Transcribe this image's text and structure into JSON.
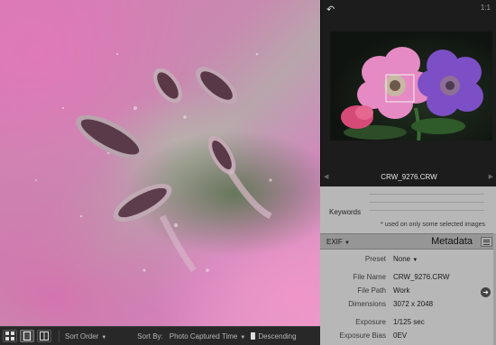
{
  "navigator": {
    "zoom": "1:1",
    "back_icon": "undo-arrow-icon",
    "filename": "CRW_9276.CRW"
  },
  "keywords": {
    "label": "Keywords",
    "note": "* used on only some selected images"
  },
  "metadata": {
    "preset_menu": "EXIF",
    "title": "Metadata",
    "rows": [
      {
        "label": "Preset",
        "value": "None"
      },
      {
        "label": "File Name",
        "value": "CRW_9276.CRW"
      },
      {
        "label": "File Path",
        "value": "Work"
      },
      {
        "label": "Dimensions",
        "value": "3072 x 2048"
      },
      {
        "label": "Exposure",
        "value": "1/125 sec"
      },
      {
        "label": "Exposure Bias",
        "value": "0EV"
      }
    ]
  },
  "toolbar": {
    "sort_order_label": "Sort Order",
    "sort_by_label": "Sort By:",
    "sort_by_value": "Photo Captured Time",
    "direction": "Descending"
  },
  "colors": {
    "panel_bg": "#b7b7b7",
    "toolbar_bg": "#282828",
    "photo_pink": "#d67ab3"
  }
}
